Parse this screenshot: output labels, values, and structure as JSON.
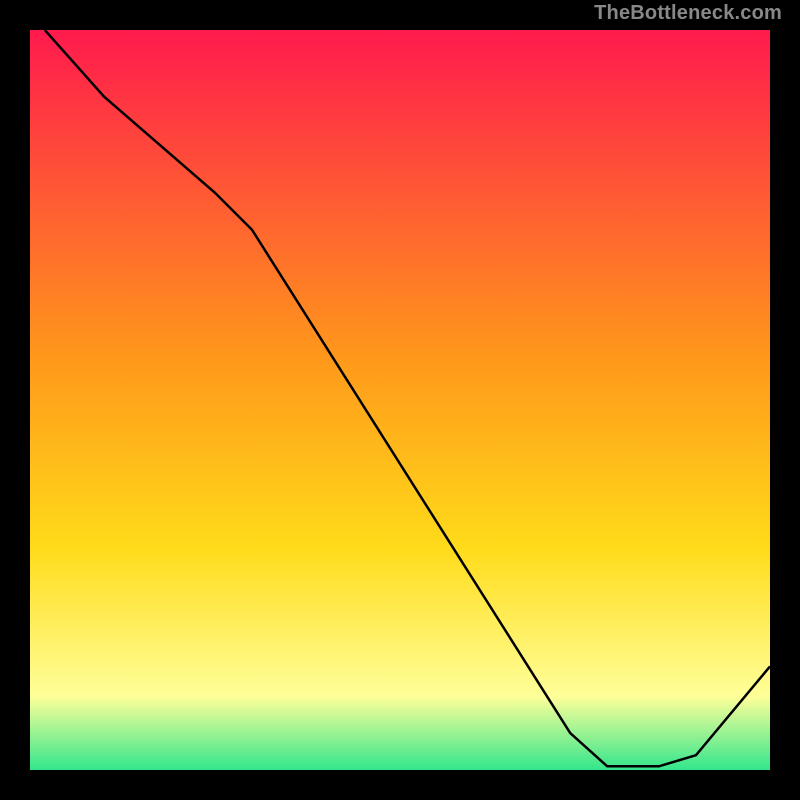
{
  "watermark": "TheBottleneck.com",
  "chart_data": {
    "type": "line",
    "title": "",
    "xlabel": "",
    "ylabel": "",
    "xlim": [
      0,
      100
    ],
    "ylim": [
      0,
      100
    ],
    "x": [
      2,
      10,
      25,
      30,
      73,
      78,
      85,
      90,
      100
    ],
    "values": [
      100,
      91,
      78,
      73,
      5,
      0.5,
      0.5,
      2,
      14
    ],
    "curve_label": {
      "text": "",
      "x": 82,
      "y": 1,
      "color": "#cc3333"
    },
    "background_gradient": {
      "top": "#ff1a4d",
      "mid": "#ffdb1a",
      "low": "#ffff99",
      "bottom": "#33e68c"
    }
  }
}
